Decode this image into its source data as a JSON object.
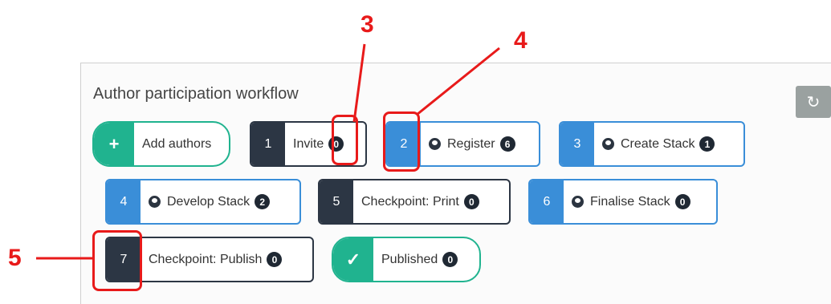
{
  "panel": {
    "title": "Author participation workflow",
    "refresh_icon": "↻"
  },
  "steps": [
    {
      "num": "+",
      "label": "Add authors",
      "badge": ""
    },
    {
      "num": "1",
      "label": "Invite",
      "badge": "0"
    },
    {
      "num": "2",
      "label": "Register",
      "badge": "6"
    },
    {
      "num": "3",
      "label": "Create Stack",
      "badge": "1"
    },
    {
      "num": "4",
      "label": "Develop Stack",
      "badge": "2"
    },
    {
      "num": "5",
      "label": "Checkpoint: Print",
      "badge": "0"
    },
    {
      "num": "6",
      "label": "Finalise Stack",
      "badge": "0"
    },
    {
      "num": "7",
      "label": "Checkpoint: Publish",
      "badge": "0"
    },
    {
      "num": "✓",
      "label": "Published",
      "badge": "0"
    }
  ],
  "annotations": {
    "a3": "3",
    "a4": "4",
    "a5": "5"
  },
  "colors": {
    "dark": "#2c3644",
    "blue": "#3a8ed8",
    "teal": "#20b38f",
    "annotation": "#e81a1a"
  }
}
